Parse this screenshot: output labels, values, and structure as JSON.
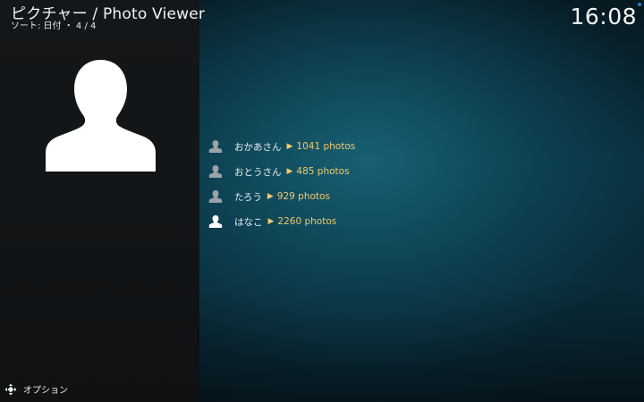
{
  "header": {
    "title": "ピクチャー / Photo Viewer",
    "subtitle": "ソート: 日付 ・ 4 / 4",
    "clock": "16:08"
  },
  "sidebar": {
    "avatar_icon": "person-silhouette-icon"
  },
  "list": {
    "items": [
      {
        "name": "おかあさん",
        "arrow": "▶",
        "count": "1041 photos",
        "icon": "user-icon",
        "selected": false
      },
      {
        "name": "おとうさん",
        "arrow": "▶",
        "count": "485 photos",
        "icon": "user-icon",
        "selected": false
      },
      {
        "name": "たろう",
        "arrow": "▶",
        "count": "929 photos",
        "icon": "user-icon",
        "selected": false
      },
      {
        "name": "はなこ",
        "arrow": "▶",
        "count": "2260 photos",
        "icon": "user-icon",
        "selected": true
      }
    ]
  },
  "footer": {
    "options_label": "オプション",
    "options_icon": "options-dpad-icon"
  },
  "colors": {
    "accent": "#f1c96b",
    "icon_dim": "#9aa3a7",
    "icon_selected": "#ffffff",
    "status_dot": "#2d7bd8"
  }
}
